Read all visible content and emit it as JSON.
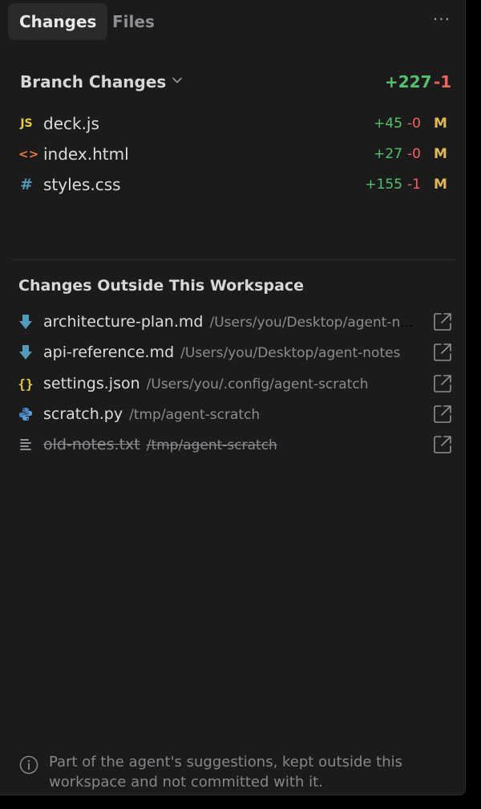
{
  "tabs": {
    "changes": "Changes",
    "files": "Files",
    "more": "···"
  },
  "branch": {
    "title": "Branch Changes",
    "additions": "+227",
    "deletions": "-1",
    "files": [
      {
        "icon": "JS",
        "icon_name": "javascript-icon",
        "name": "deck.js",
        "additions": "+45",
        "deletions": "-0",
        "status": "M"
      },
      {
        "icon": "<>",
        "icon_name": "html-icon",
        "name": "index.html",
        "additions": "+27",
        "deletions": "-0",
        "status": "M"
      },
      {
        "icon": "#",
        "icon_name": "css-icon",
        "name": "styles.css",
        "additions": "+155",
        "deletions": "-1",
        "status": "M"
      }
    ]
  },
  "outside": {
    "title": "Changes Outside This Workspace",
    "files": [
      {
        "icon_name": "markdown-icon",
        "name": "architecture-plan.md",
        "path": "/Users/you/Desktop/agent-notes"
      },
      {
        "icon_name": "markdown-icon",
        "name": "api-reference.md",
        "path": "/Users/you/Desktop/agent-notes"
      },
      {
        "icon_name": "json-icon",
        "name": "settings.json",
        "path": "/Users/you/.config/agent-scratch"
      },
      {
        "icon_name": "python-icon",
        "name": "scratch.py",
        "path": "/tmp/agent-scratch"
      },
      {
        "icon_name": "text-file-icon",
        "name": "old-notes.txt",
        "path": "/tmp/agent-scratch",
        "deleted": true
      }
    ]
  },
  "footer": {
    "text": "Part of the agent's suggestions, kept outside this workspace and not committed with it."
  },
  "colors": {
    "added": "#56c16d",
    "deleted": "#f0655b",
    "modified": "#e0b85a",
    "js": "#e5c94a",
    "html": "#e5793f",
    "css": "#519aba",
    "markdown": "#519aba",
    "json": "#e5c94a"
  }
}
